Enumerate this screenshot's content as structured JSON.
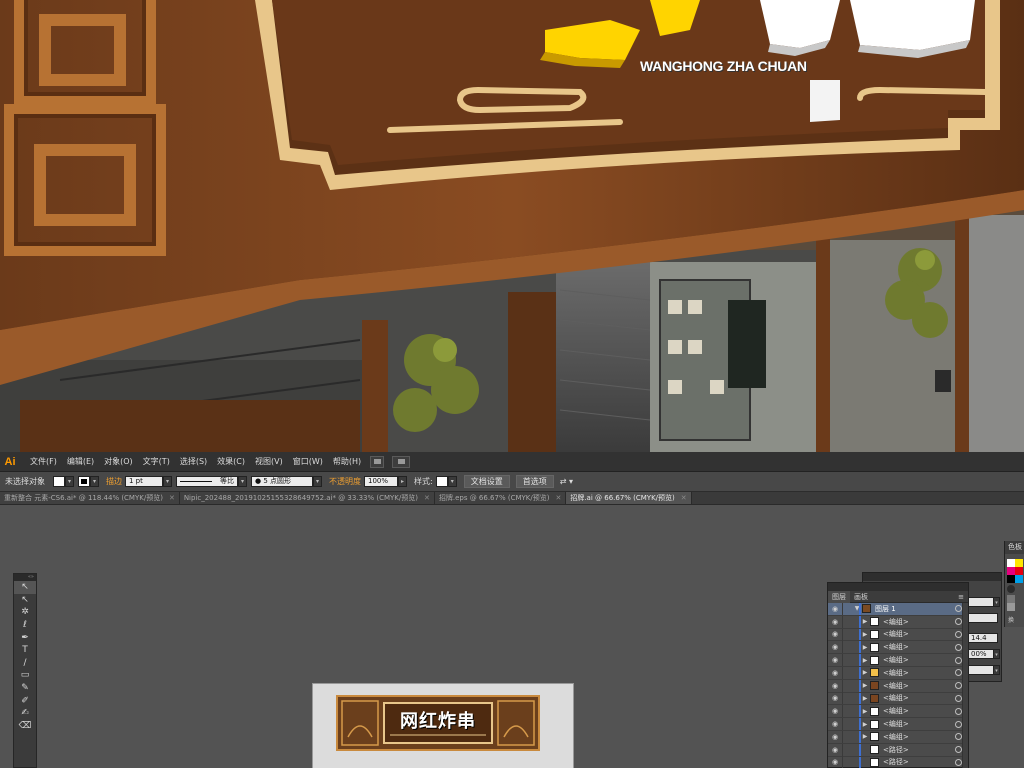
{
  "hero": {
    "brand_roman": "WANGHONG ZHA CHUAN"
  },
  "menubar": {
    "app_logo": "Ai",
    "items": [
      "文件(F)",
      "编辑(E)",
      "对象(O)",
      "文字(T)",
      "选择(S)",
      "效果(C)",
      "视图(V)",
      "窗口(W)",
      "帮助(H)"
    ]
  },
  "controlbar": {
    "selection": "未选择对象",
    "stroke_label": "描边",
    "stroke_width": "1 pt",
    "stroke_profile": "等比",
    "brush": "5 点圆形",
    "opacity_label": "不透明度",
    "opacity": "100%",
    "style_label": "样式:",
    "doc_setup": "文档设置",
    "preferences": "首选项"
  },
  "tabs": [
    {
      "title": "重新整合 元素-CS6.ai* @ 118.44% (CMYK/预览)",
      "active": false
    },
    {
      "title": "Nipic_202488_20191025155328649752.ai* @ 33.33% (CMYK/预览)",
      "active": false
    },
    {
      "title": "招牌.eps @ 66.67% (CMYK/预览)",
      "active": false
    },
    {
      "title": "招牌.ai @ 66.67% (CMYK/预览)",
      "active": true
    }
  ],
  "tools": {
    "items": [
      "selection-tool",
      "direct-selection-tool",
      "magic-wand-tool",
      "lasso-tool",
      "pen-tool",
      "type-tool",
      "line-tool",
      "rectangle-tool",
      "paintbrush-tool",
      "pencil-tool",
      "blob-brush-tool",
      "eraser-tool"
    ],
    "glyphs": [
      "↖",
      "↖",
      "✲",
      "ℓ",
      "✒",
      "T",
      "∕",
      "▭",
      "✎",
      "✐",
      "✍",
      "⌫"
    ]
  },
  "layers_panel": {
    "tabs": [
      "图层",
      "画板"
    ],
    "layer_name": "图层 1",
    "rows": [
      "<编组>",
      "<编组>",
      "<编组>",
      "<编组>",
      "<编组>",
      "<编组>",
      "<编组>",
      "<编组>",
      "<编组>",
      "<编组>",
      "<路径>",
      "<路径>"
    ]
  },
  "back_panel": {
    "value_1": "14.4",
    "value_2": "00%"
  },
  "color_panel": {
    "title": "色板",
    "footer": "换"
  },
  "mini_sign": {
    "text": "网红炸串"
  }
}
